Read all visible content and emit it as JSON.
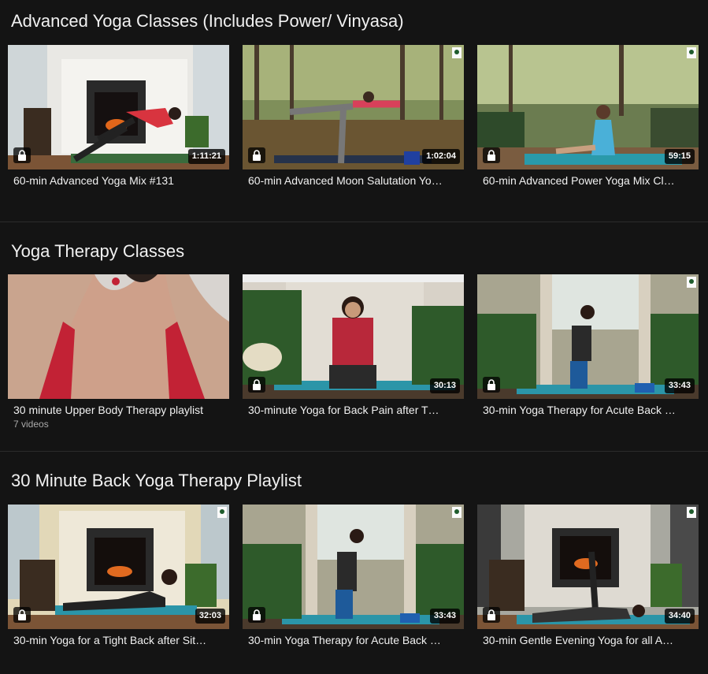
{
  "sections": [
    {
      "title": "Advanced Yoga Classes (Includes Power/ Vinyasa)",
      "cards": [
        {
          "title": "60-min Advanced Yoga Mix #131",
          "duration": "1:11:21"
        },
        {
          "title": "60-min Advanced Moon Salutation Yo…",
          "duration": "1:02:04"
        },
        {
          "title": "60-min Advanced Power Yoga Mix Cl…",
          "duration": "59:15"
        }
      ]
    },
    {
      "title": "Yoga Therapy Classes",
      "cards": [
        {
          "title": "30 minute Upper Body Therapy playlist",
          "meta": "7 videos"
        },
        {
          "title": "30-minute Yoga for Back Pain after T…",
          "duration": "30:13"
        },
        {
          "title": "30-min Yoga Therapy for Acute Back …",
          "duration": "33:43"
        }
      ]
    },
    {
      "title": "30 Minute Back Yoga Therapy Playlist",
      "cards": [
        {
          "title": "30-min Yoga for a Tight Back after Sit…",
          "duration": "32:03"
        },
        {
          "title": "30-min Yoga Therapy for Acute Back …",
          "duration": "33:43"
        },
        {
          "title": "30-min Gentle Evening Yoga for all A…",
          "duration": "34:40"
        }
      ]
    }
  ],
  "icons": {
    "lock": "lock-icon",
    "badge": "channel-logo-icon"
  },
  "colors": {
    "background": "#141414",
    "text": "#f1f1f1",
    "meta": "#aaaaaa"
  }
}
